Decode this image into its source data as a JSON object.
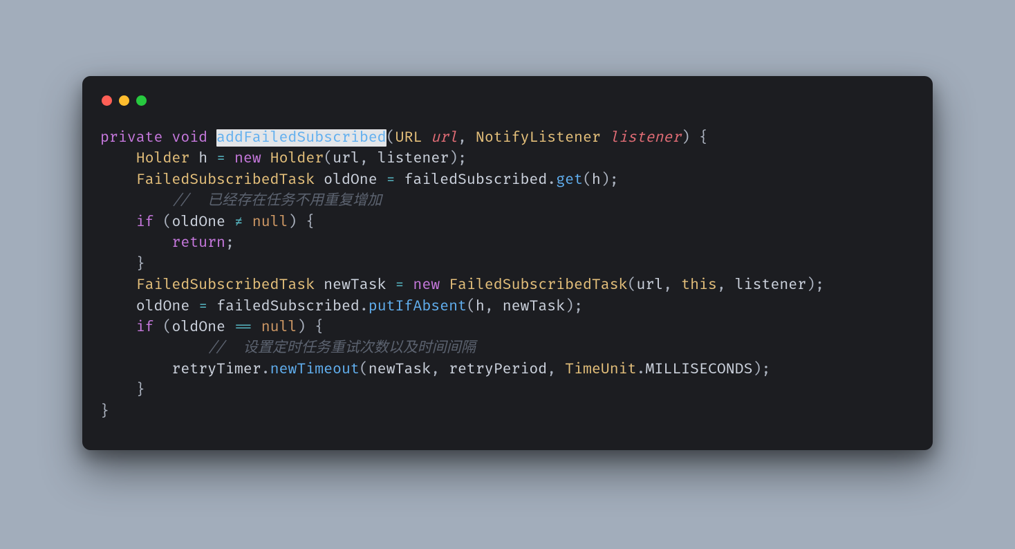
{
  "window": {
    "buttons": [
      "close",
      "minimize",
      "zoom"
    ]
  },
  "code": {
    "line1": {
      "kw_private": "private",
      "kw_void": "void",
      "fn_name": "addFailedSubscribed",
      "p1_type": "URL",
      "p1_name": "url",
      "p2_type": "NotifyListener",
      "p2_name": "listener"
    },
    "line2": {
      "type": "Holder",
      "var": "h",
      "kw_new": "new",
      "ctor": "Holder",
      "arg1": "url",
      "arg2": "listener"
    },
    "line3": {
      "type": "FailedSubscribedTask",
      "var": "oldOne",
      "obj": "failedSubscribed",
      "method": "get",
      "arg": "h"
    },
    "line4": {
      "comment": "//  已经存在任务不用重复增加"
    },
    "line5": {
      "kw_if": "if",
      "lhs": "oldOne",
      "op": "≠",
      "rhs": "null"
    },
    "line6": {
      "kw_return": "return"
    },
    "line8": {
      "type": "FailedSubscribedTask",
      "var": "newTask",
      "kw_new": "new",
      "ctor": "FailedSubscribedTask",
      "arg1": "url",
      "arg2": "this",
      "arg3": "listener"
    },
    "line9": {
      "lhs": "oldOne",
      "obj": "failedSubscribed",
      "method": "putIfAbsent",
      "arg1": "h",
      "arg2": "newTask"
    },
    "line10": {
      "kw_if": "if",
      "lhs": "oldOne",
      "op": "==",
      "rhs": "null"
    },
    "line11": {
      "comment": "//  设置定时任务重试次数以及时间间隔"
    },
    "line12": {
      "obj": "retryTimer",
      "method": "newTimeout",
      "arg1": "newTask",
      "arg2": "retryPeriod",
      "arg3_obj": "TimeUnit",
      "arg3_field": "MILLISECONDS"
    }
  }
}
